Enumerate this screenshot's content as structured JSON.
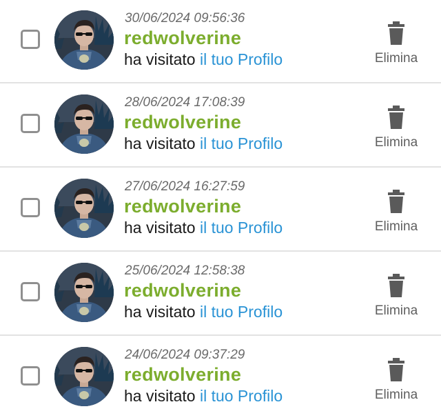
{
  "colors": {
    "username": "#7cad2e",
    "link": "#2a93d5",
    "icon": "#5a5a5a",
    "divider": "#e2e2e2"
  },
  "visits": [
    {
      "timestamp": "30/06/2024 09:56:36",
      "username": "redwolverine",
      "action_text": "ha visitato",
      "link_text": "il tuo Profilo",
      "delete_label": "Elimina",
      "avatar_icon": "user-avatar",
      "delete_icon": "trash-icon"
    },
    {
      "timestamp": "28/06/2024 17:08:39",
      "username": "redwolverine",
      "action_text": "ha visitato",
      "link_text": "il tuo Profilo",
      "delete_label": "Elimina",
      "avatar_icon": "user-avatar",
      "delete_icon": "trash-icon"
    },
    {
      "timestamp": "27/06/2024 16:27:59",
      "username": "redwolverine",
      "action_text": "ha visitato",
      "link_text": "il tuo Profilo",
      "delete_label": "Elimina",
      "avatar_icon": "user-avatar",
      "delete_icon": "trash-icon"
    },
    {
      "timestamp": "25/06/2024 12:58:38",
      "username": "redwolverine",
      "action_text": "ha visitato",
      "link_text": "il tuo Profilo",
      "delete_label": "Elimina",
      "avatar_icon": "user-avatar",
      "delete_icon": "trash-icon"
    },
    {
      "timestamp": "24/06/2024 09:37:29",
      "username": "redwolverine",
      "action_text": "ha visitato",
      "link_text": "il tuo Profilo",
      "delete_label": "Elimina",
      "avatar_icon": "user-avatar",
      "delete_icon": "trash-icon"
    }
  ]
}
